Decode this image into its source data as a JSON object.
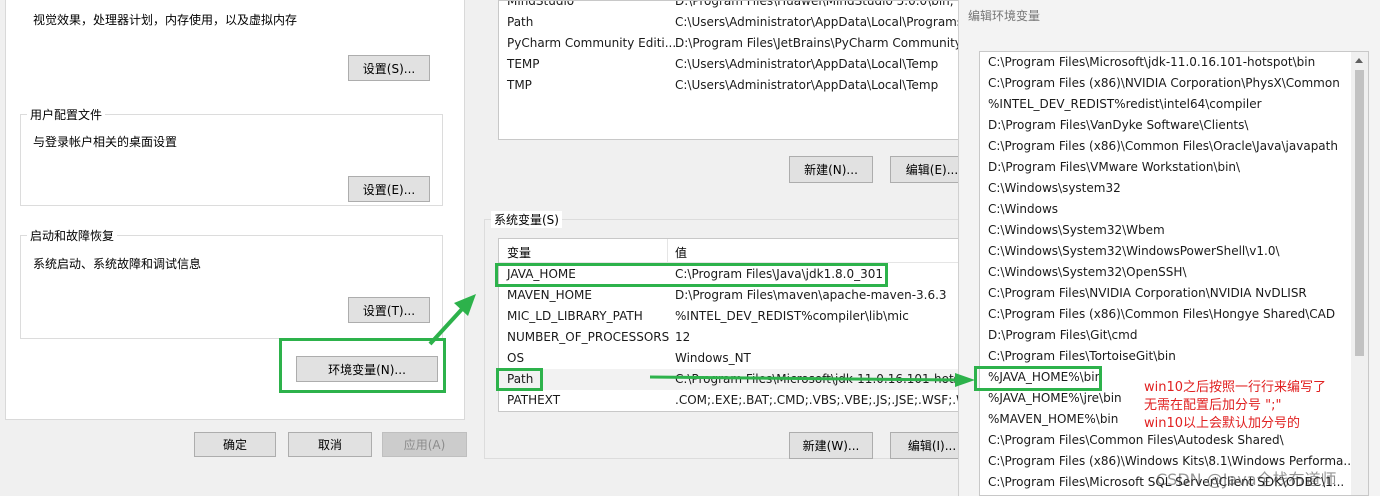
{
  "left_panel": {
    "performance_desc": "视觉效果，处理器计划，内存使用，以及虚拟内存",
    "performance_settings_btn": "设置(S)...",
    "user_profiles": {
      "title": "用户配置文件",
      "desc": "与登录帐户相关的桌面设置",
      "settings_btn": "设置(E)..."
    },
    "startup_recovery": {
      "title": "启动和故障恢复",
      "desc": "系统启动、系统故障和调试信息",
      "settings_btn": "设置(T)..."
    },
    "env_vars_btn": "环境变量(N)...",
    "ok_btn": "确定",
    "cancel_btn": "取消",
    "apply_btn": "应用(A)"
  },
  "middle_panel": {
    "user_vars": [
      {
        "name": "MindStudio",
        "value": "D:\\Program Files\\Huawei\\MindStudio 5.0.0\\bin;"
      },
      {
        "name": "Path",
        "value": "C:\\Users\\Administrator\\AppData\\Local\\Programs"
      },
      {
        "name": "PyCharm Community Editi...",
        "value": "D:\\Program Files\\JetBrains\\PyCharm Community"
      },
      {
        "name": "TEMP",
        "value": "C:\\Users\\Administrator\\AppData\\Local\\Temp"
      },
      {
        "name": "TMP",
        "value": "C:\\Users\\Administrator\\AppData\\Local\\Temp"
      }
    ],
    "user_new_btn": "新建(N)...",
    "user_edit_btn": "编辑(E)...",
    "system_vars_title": "系统变量(S)",
    "col_variable": "变量",
    "col_value": "值",
    "system_vars": [
      {
        "name": "JAVA_HOME",
        "value": "C:\\Program Files\\Java\\jdk1.8.0_301"
      },
      {
        "name": "MAVEN_HOME",
        "value": "D:\\Program Files\\maven\\apache-maven-3.6.3"
      },
      {
        "name": "MIC_LD_LIBRARY_PATH",
        "value": "%INTEL_DEV_REDIST%compiler\\lib\\mic"
      },
      {
        "name": "NUMBER_OF_PROCESSORS",
        "value": "12"
      },
      {
        "name": "OS",
        "value": "Windows_NT"
      },
      {
        "name": "Path",
        "value": "C:\\Program Files\\Microsoft\\jdk-11.0.16.101-hots"
      },
      {
        "name": "PATHEXT",
        "value": ".COM;.EXE;.BAT;.CMD;.VBS;.VBE;.JS;.JSE;.WSF;.WSH"
      }
    ],
    "sys_new_btn": "新建(W)...",
    "sys_edit_btn": "编辑(I)..."
  },
  "right_panel": {
    "title": "编辑环境变量",
    "paths": [
      "C:\\Program Files\\Microsoft\\jdk-11.0.16.101-hotspot\\bin",
      "C:\\Program Files (x86)\\NVIDIA Corporation\\PhysX\\Common",
      "%INTEL_DEV_REDIST%redist\\intel64\\compiler",
      "D:\\Program Files\\VanDyke Software\\Clients\\",
      "C:\\Program Files (x86)\\Common Files\\Oracle\\Java\\javapath",
      "D:\\Program Files\\VMware Workstation\\bin\\",
      "C:\\Windows\\system32",
      "C:\\Windows",
      "C:\\Windows\\System32\\Wbem",
      "C:\\Windows\\System32\\WindowsPowerShell\\v1.0\\",
      "C:\\Windows\\System32\\OpenSSH\\",
      "C:\\Program Files\\NVIDIA Corporation\\NVIDIA NvDLISR",
      "C:\\Program Files (x86)\\Common Files\\Hongye Shared\\CAD",
      "D:\\Program Files\\Git\\cmd",
      "C:\\Program Files\\TortoiseGit\\bin",
      "%JAVA_HOME%\\bin",
      "%JAVA_HOME%\\jre\\bin",
      "%MAVEN_HOME%\\bin",
      "C:\\Program Files\\Common Files\\Autodesk Shared\\",
      "C:\\Program Files (x86)\\Windows Kits\\8.1\\Windows Performa...",
      "C:\\Program Files\\Microsoft SQL Server\\Client SDK\\ODBC\\1..."
    ]
  },
  "annotation": {
    "line1": "win10之后按照一行行来编写了",
    "line2": "无需在配置后加分号 \";\"",
    "line3": "win10以上会默认加分号的",
    "color": "#e02020"
  },
  "watermark": "CSDN @Java全栈布道师",
  "colors": {
    "highlight_green": "#2db24b",
    "annotation_red": "#e02020"
  }
}
